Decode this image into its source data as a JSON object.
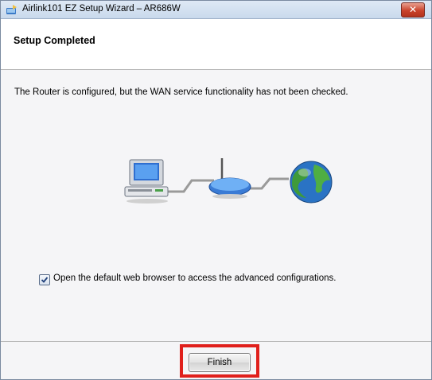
{
  "window": {
    "title": "Airlink101 EZ Setup Wizard – AR686W",
    "close_icon": "✕"
  },
  "header": {
    "title": "Setup Completed"
  },
  "main": {
    "message": "The Router is configured, but the WAN service functionality has not been checked.",
    "illustration_icons": [
      "computer-icon",
      "router-icon",
      "globe-icon"
    ],
    "open_browser_checkbox": {
      "label": "Open the default web browser to access the advanced configurations.",
      "checked": true
    }
  },
  "footer": {
    "finish_label": "Finish"
  },
  "colors": {
    "highlight": "#e0201c",
    "titlebar": "#c9d9ec",
    "close": "#c9432b"
  }
}
